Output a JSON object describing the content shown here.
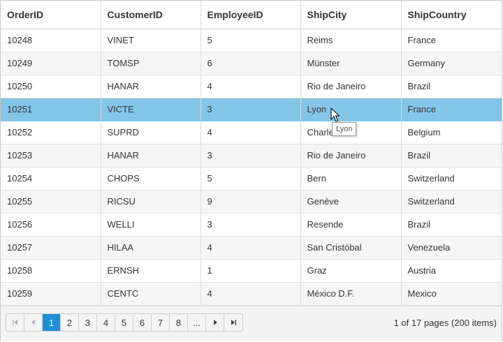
{
  "columns": [
    "OrderID",
    "CustomerID",
    "EmployeeID",
    "ShipCity",
    "ShipCountry"
  ],
  "rows": [
    [
      "10248",
      "VINET",
      "5",
      "Reims",
      "France"
    ],
    [
      "10249",
      "TOMSP",
      "6",
      "Münster",
      "Germany"
    ],
    [
      "10250",
      "HANAR",
      "4",
      "Rio de Janeiro",
      "Brazil"
    ],
    [
      "10251",
      "VICTE",
      "3",
      "Lyon",
      "France"
    ],
    [
      "10252",
      "SUPRD",
      "4",
      "Charle",
      "Belgium"
    ],
    [
      "10253",
      "HANAR",
      "3",
      "Rio de Janeiro",
      "Brazil"
    ],
    [
      "10254",
      "CHOPS",
      "5",
      "Bern",
      "Switzerland"
    ],
    [
      "10255",
      "RICSU",
      "9",
      "Genève",
      "Switzerland"
    ],
    [
      "10256",
      "WELLI",
      "3",
      "Resende",
      "Brazil"
    ],
    [
      "10257",
      "HILAA",
      "4",
      "San Cristóbal",
      "Venezuela"
    ],
    [
      "10258",
      "ERNSH",
      "1",
      "Graz",
      "Austria"
    ],
    [
      "10259",
      "CENTC",
      "4",
      "México D.F.",
      "Mexico"
    ]
  ],
  "selected_row_index": 3,
  "tooltip": {
    "text": "Lyon"
  },
  "pager": {
    "pages": [
      "1",
      "2",
      "3",
      "4",
      "5",
      "6",
      "7",
      "8",
      "..."
    ],
    "current_page": "1",
    "info": "1 of 17 pages (200 items)",
    "icons": {
      "first": "first-page-icon",
      "prev": "prev-page-icon",
      "next": "next-page-icon",
      "last": "last-page-icon"
    }
  },
  "colors": {
    "selected_row": "#84c6e8",
    "current_page": "#1e90d8",
    "alt_row": "#f6f6f6"
  }
}
